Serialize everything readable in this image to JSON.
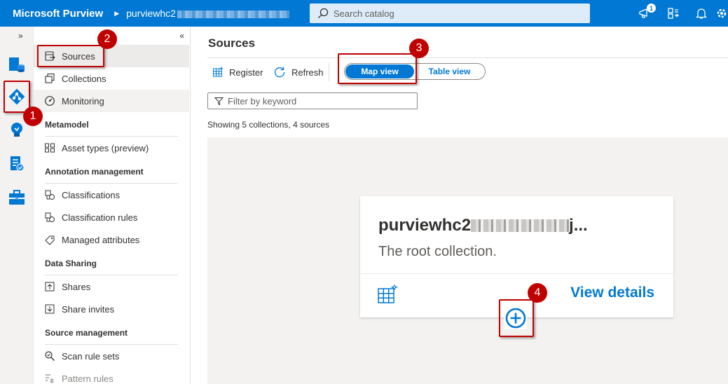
{
  "header": {
    "brand": "Microsoft Purview",
    "account": "purviewhc2",
    "search_placeholder": "Search catalog",
    "notification_count": "1"
  },
  "nav": {
    "items": [
      {
        "label": "Sources"
      },
      {
        "label": "Collections"
      },
      {
        "label": "Monitoring"
      },
      {
        "label": "Asset types (preview)"
      },
      {
        "label": "Classifications"
      },
      {
        "label": "Classification rules"
      },
      {
        "label": "Managed attributes"
      },
      {
        "label": "Shares"
      },
      {
        "label": "Share invites"
      },
      {
        "label": "Scan rule sets"
      },
      {
        "label": "Pattern rules"
      }
    ],
    "sections": [
      "Metamodel",
      "Annotation management",
      "Data Sharing",
      "Source management"
    ]
  },
  "main": {
    "title": "Sources",
    "toolbar": {
      "register": "Register",
      "refresh": "Refresh"
    },
    "toggle": {
      "map_view": "Map view",
      "table_view": "Table view"
    },
    "filter_placeholder": "Filter by keyword",
    "showing": "Showing 5 collections, 4 sources",
    "card": {
      "title": "purviewhc2",
      "title_suffix": "j...",
      "subtitle": "The root collection.",
      "view_details": "View details"
    }
  },
  "callouts": [
    "1",
    "2",
    "3",
    "4"
  ],
  "colors": {
    "accent": "#0078d4",
    "callout": "#c00000"
  }
}
